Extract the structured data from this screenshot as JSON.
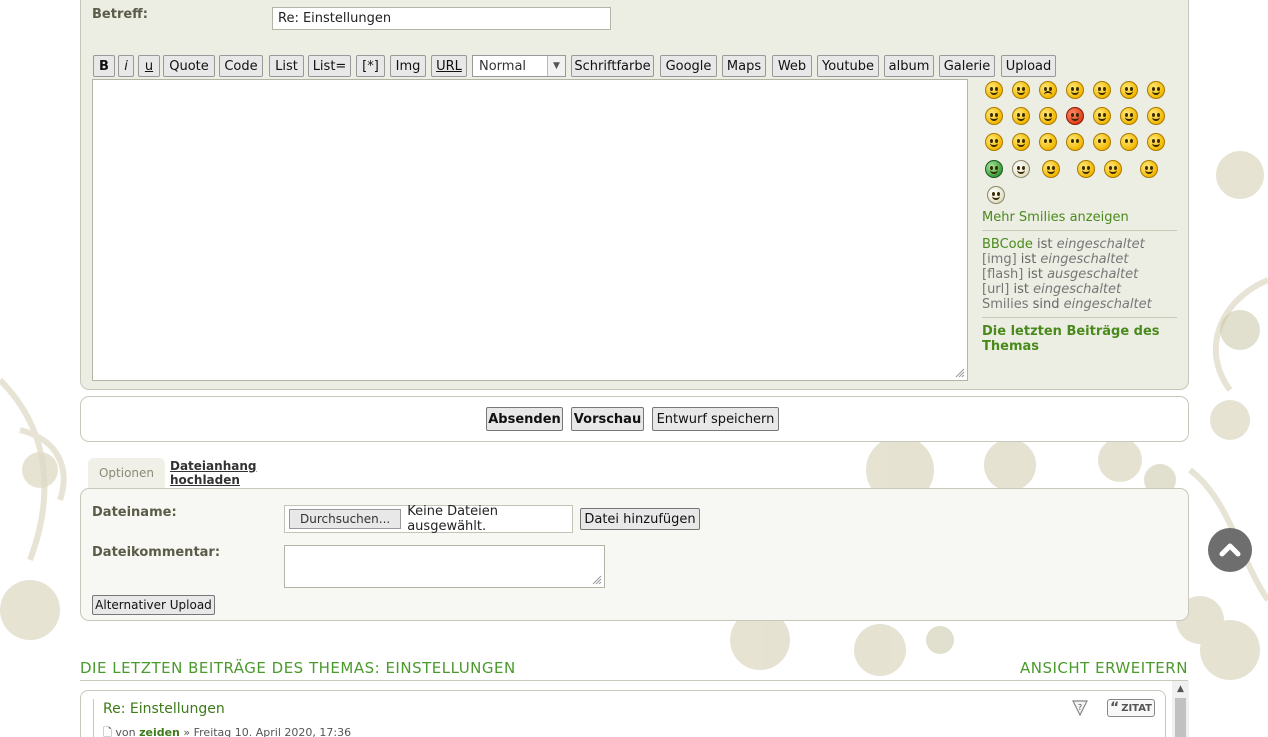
{
  "subject": {
    "label": "Betreff:",
    "value": "Re: Einstellungen"
  },
  "toolbar": {
    "buttons": [
      "B",
      "i",
      "u",
      "Quote",
      "Code",
      "List",
      "List=",
      "[*]",
      "Img",
      "URL"
    ],
    "font_size_select": "Normal",
    "buttons2": [
      "Schriftfarbe",
      "Google",
      "Maps",
      "Web",
      "Youtube",
      "album",
      "Galerie",
      "Upload"
    ]
  },
  "sidebar": {
    "more_smilies": "Mehr Smilies anzeigen",
    "status": [
      {
        "name": "BBCode",
        "mid": " ist ",
        "state": "eingeschaltet"
      },
      {
        "name": "[img]",
        "mid": " ist ",
        "state": "eingeschaltet"
      },
      {
        "name": "[flash]",
        "mid": " ist ",
        "state": "ausgeschaltet"
      },
      {
        "name": "[url]",
        "mid": " ist ",
        "state": "eingeschaltet"
      },
      {
        "name": "Smilies",
        "mid": " sind ",
        "state": "eingeschaltet"
      }
    ],
    "last_posts_link": "Die letzten Beiträge des Themas"
  },
  "actions": {
    "submit": "Absenden",
    "preview": "Vorschau",
    "save_draft": "Entwurf speichern"
  },
  "tabs": {
    "options": "Optionen",
    "attachment": "Dateianhang hochladen"
  },
  "upload": {
    "filename_label": "Dateiname:",
    "browse": "Durchsuchen...",
    "no_file": "Keine Dateien ausgewählt.",
    "add_file": "Datei hinzufügen",
    "comment_label": "Dateikommentar:",
    "alt_upload": "Alternativer Upload"
  },
  "recent": {
    "title": "DIE LETZTEN BEITRÄGE DES THEMAS: EINSTELLUNGEN",
    "expand": "ANSICHT ERWEITERN",
    "post_title": "Re: Einstellungen",
    "post_by": "von",
    "post_author": "zeiden",
    "post_date": "» Freitag 10. April 2020, 17:36",
    "quote_button": "ZITAT"
  }
}
